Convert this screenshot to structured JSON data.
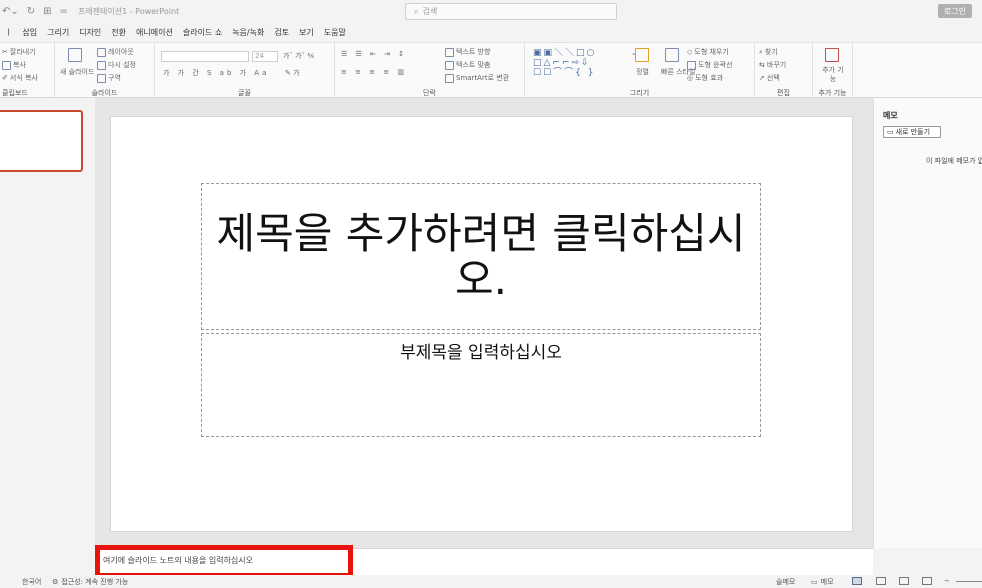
{
  "titlebar": {
    "undo_icon": "undo-icon",
    "redo_icon": "redo-icon",
    "pin_icon": "pin-icon",
    "separator": "=",
    "doc_title": "프레젠테이션1 - PowerPoint",
    "search_placeholder": "검색",
    "login": "로그인"
  },
  "tabs": [
    "삽입",
    "그리기",
    "디자인",
    "전환",
    "애니메이션",
    "슬라이드 쇼",
    "녹음/녹화",
    "검토",
    "보기",
    "도움말"
  ],
  "ribbon": {
    "clipboard": {
      "label": "클립보드",
      "cut": "잘라내기",
      "copy": "복사",
      "format_painter": "서식 복사"
    },
    "slides": {
      "label": "슬라이드",
      "new_slide": "새 슬라이드",
      "layout": "레이아웃",
      "reset": "다시 설정",
      "section": "구역"
    },
    "font": {
      "label": "글꼴",
      "size": "24",
      "buttons": "가 가 간 S ab 가 Aa"
    },
    "paragraph": {
      "label": "단락",
      "text_direction": "텍스트 방향",
      "align_text": "텍스트 맞춤",
      "smartart": "SmartArt로 변환"
    },
    "drawing": {
      "label": "그리기",
      "arrange": "정렬",
      "quick_styles": "빠른 스타일",
      "shape_fill": "도형 채우기",
      "shape_outline": "도형 윤곽선",
      "shape_effects": "도형 효과"
    },
    "editing": {
      "label": "편집",
      "find": "찾기",
      "replace": "바꾸기",
      "select": "선택"
    },
    "addins": {
      "label": "추가 기능",
      "addin": "추가 기능"
    }
  },
  "slide": {
    "title_placeholder": "제목을 추가하려면 클릭하십시오.",
    "subtitle_placeholder": "부제목을 입력하십시오"
  },
  "comments": {
    "title": "메모",
    "new_comment": "새로 만들기",
    "empty": "이 파일에 메모가 없"
  },
  "notes": {
    "placeholder": "여기에 슬라이드 노트의 내용을 입력하십시오"
  },
  "statusbar": {
    "language": "한국어",
    "accessibility": "접근성: 계속 진행 가능",
    "notes_btn": "슬메모",
    "comments_btn": "메모"
  },
  "colors": {
    "highlight": "#e8140c",
    "thumb_border": "#c84b31"
  }
}
